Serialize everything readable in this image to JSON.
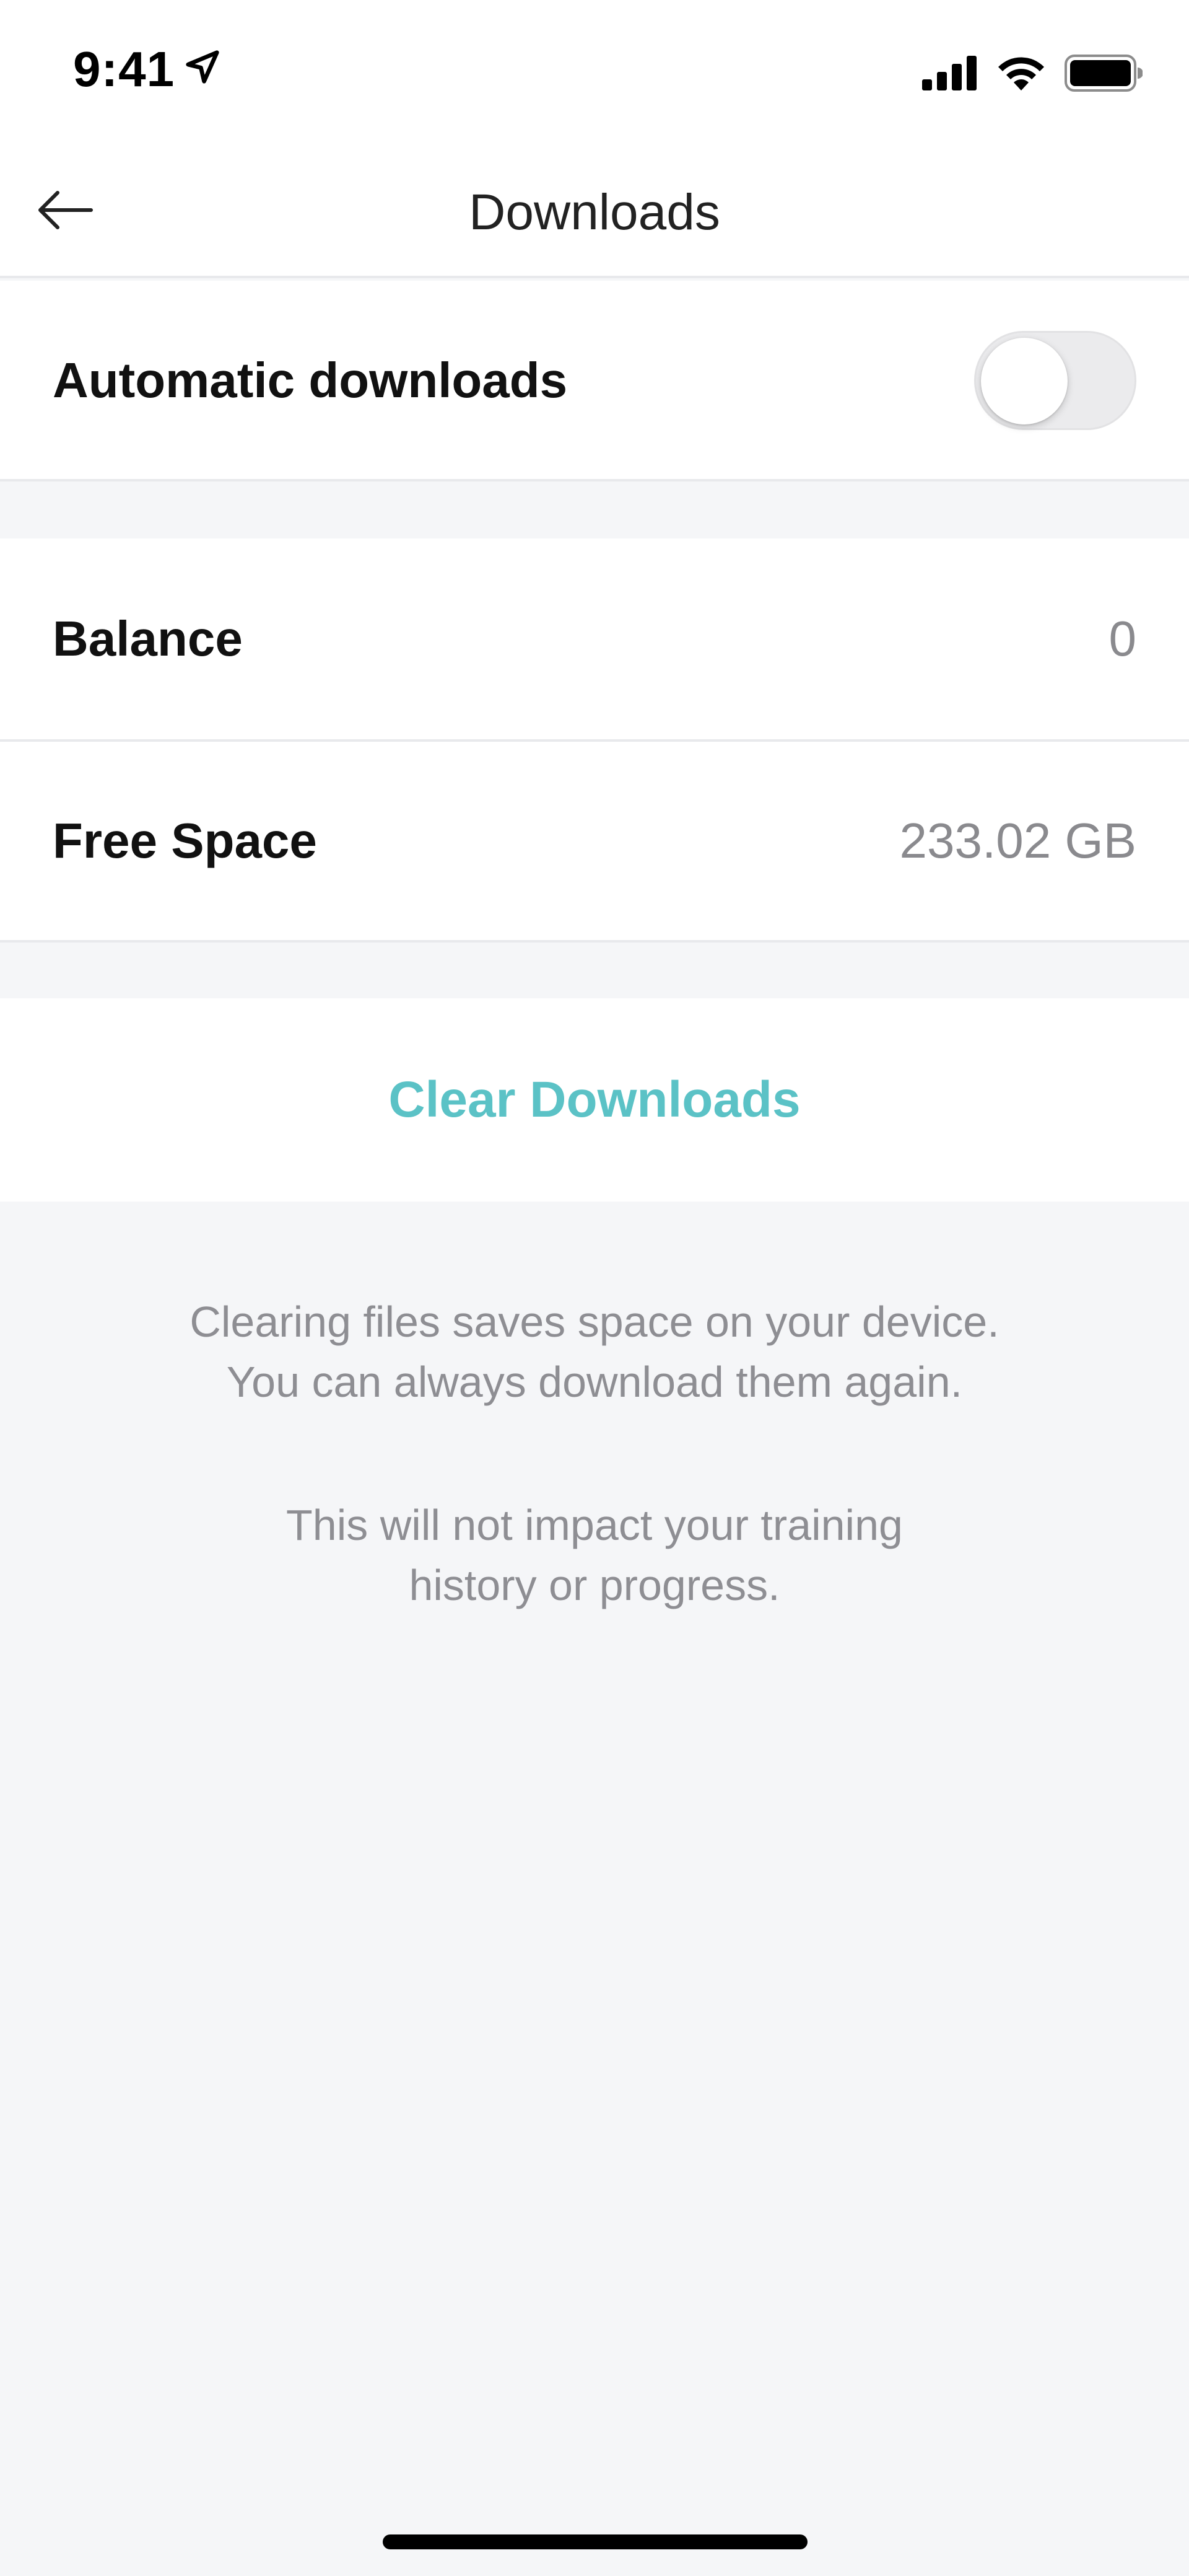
{
  "status_bar": {
    "time": "9:41",
    "icons": [
      "location-arrow-icon",
      "cellular-signal-icon",
      "wifi-icon",
      "battery-icon"
    ]
  },
  "nav": {
    "back_icon": "arrow-left-icon",
    "title": "Downloads"
  },
  "settings": {
    "automatic_downloads": {
      "label": "Automatic downloads",
      "enabled": false
    },
    "balance": {
      "label": "Balance",
      "value": "0"
    },
    "free_space": {
      "label": "Free Space",
      "value": "233.02 GB"
    }
  },
  "clear_button": {
    "label": "Clear Downloads",
    "color": "#5bc2c6"
  },
  "info": {
    "paragraph1_line1": "Clearing files saves space on your device.",
    "paragraph1_line2": "You can always download them again.",
    "paragraph2_line1": "This will not impact your training",
    "paragraph2_line2": "history or progress."
  }
}
